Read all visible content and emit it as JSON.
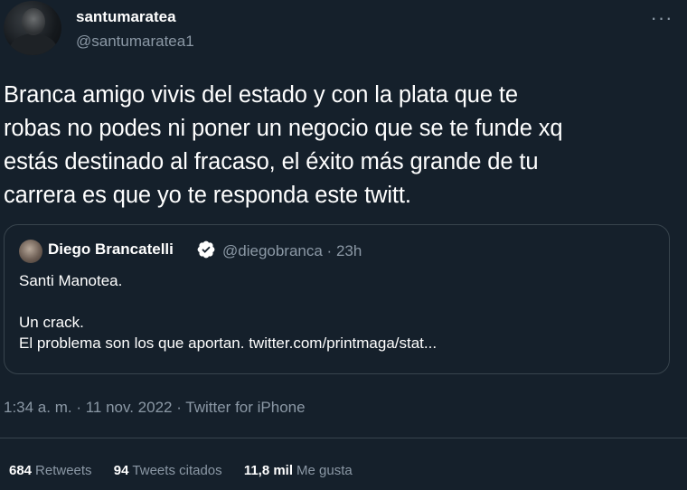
{
  "author": {
    "display_name": "santumaratea",
    "handle": "@santumaratea1"
  },
  "more_label": "···",
  "tweet": {
    "text": "Branca amigo vivis del estado y con la plata que te\nrobas no podes ni poner un negocio que se te funde xq\nestás destinado al fracaso, el éxito más grande de tu\ncarrera es que yo te responda este twitt."
  },
  "quote": {
    "display_name": "Diego Brancatelli",
    "meta": "@diegobranca · 23h",
    "line1": "Santi Manotea.",
    "line2": "Un crack.",
    "line3": "El problema son los que aportan. twitter.com/printmaga/stat..."
  },
  "timestamp": "1:34 a. m. · 11 nov. 2022 · Twitter for iPhone",
  "stats": {
    "retweets_count": "684",
    "retweets_label": "Retweets",
    "quotes_count": "94",
    "quotes_label": "Tweets citados",
    "likes_count": "11,8 mil",
    "likes_label": "Me gusta"
  },
  "colors": {
    "background": "#15202b",
    "text": "#ffffff",
    "secondary_text": "#8b98a5",
    "border": "#38444d",
    "verified": "#ffffff"
  },
  "icons": [
    "verified-badge-icon",
    "more-options-icon"
  ]
}
